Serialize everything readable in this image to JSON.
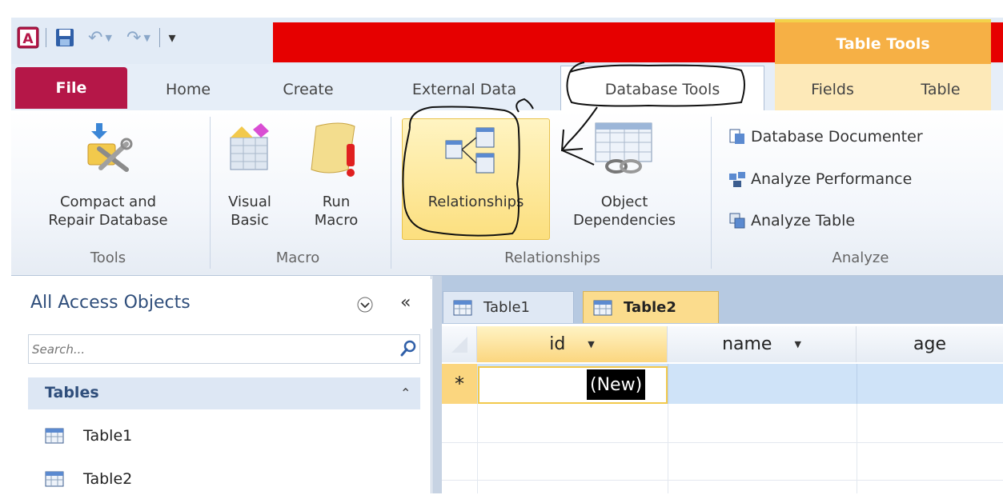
{
  "titlebar": {
    "contextual_group": "Table Tools"
  },
  "tabs": {
    "file": "File",
    "home": "Home",
    "create": "Create",
    "external_data": "External Data",
    "database_tools": "Database Tools",
    "fields": "Fields",
    "table": "Table"
  },
  "ribbon": {
    "tools": {
      "compact_line1": "Compact and",
      "compact_line2": "Repair Database",
      "group_label": "Tools"
    },
    "macro": {
      "visual_basic_line1": "Visual",
      "visual_basic_line2": "Basic",
      "run_macro_line1": "Run",
      "run_macro_line2": "Macro",
      "group_label": "Macro"
    },
    "relationships": {
      "relationships_label": "Relationships",
      "object_dep_line1": "Object",
      "object_dep_line2": "Dependencies",
      "group_label": "Relationships"
    },
    "analyze": {
      "documenter": "Database Documenter",
      "performance": "Analyze Performance",
      "table": "Analyze Table",
      "group_label": "Analyze"
    }
  },
  "nav": {
    "title": "All Access Objects",
    "search_placeholder": "Search...",
    "section": "Tables",
    "items": [
      "Table1",
      "Table2"
    ]
  },
  "document": {
    "tabs": [
      "Table1",
      "Table2"
    ],
    "columns": [
      "id",
      "name",
      "age"
    ],
    "new_row_marker": "*",
    "new_value": "(New)"
  },
  "colors": {
    "file_tab": "#b51748",
    "title_red": "#e60000",
    "contextual": "#f6b045",
    "highlight": "#fcdf7e"
  }
}
